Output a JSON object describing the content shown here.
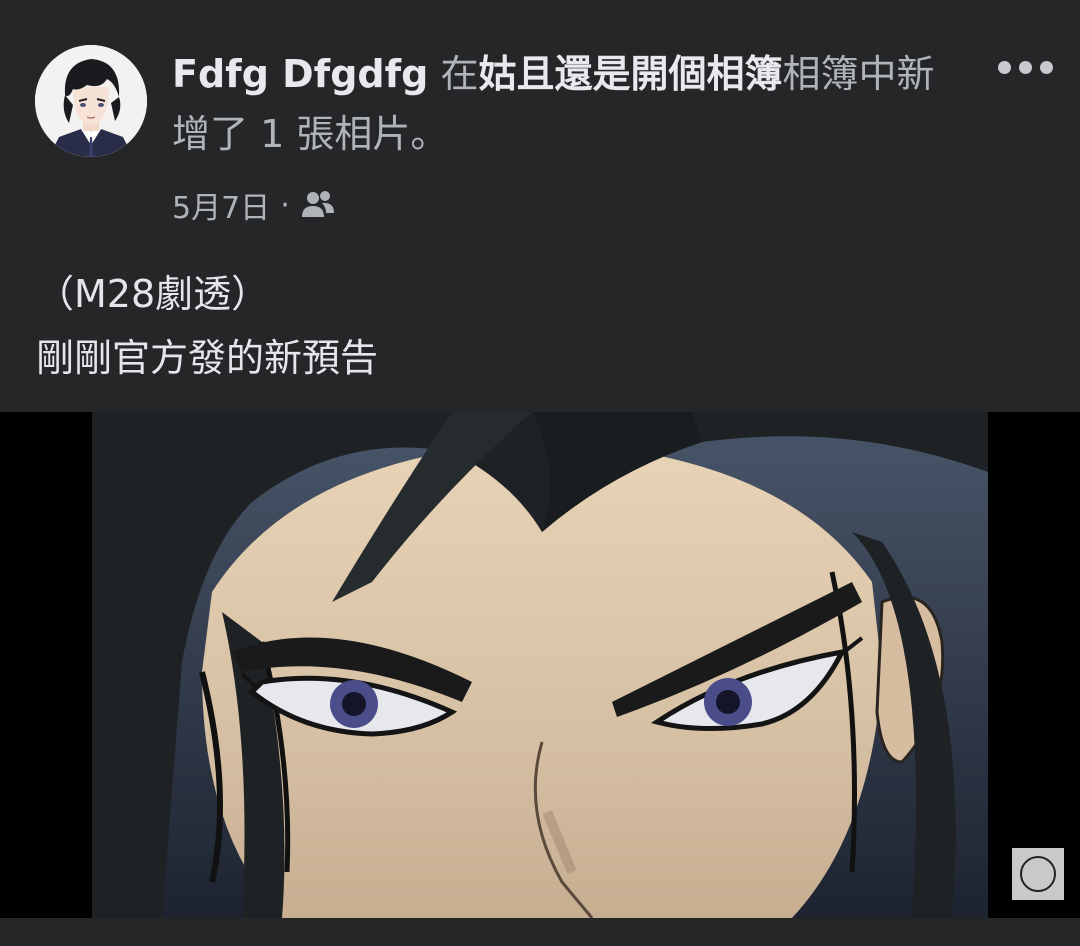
{
  "post": {
    "author": "Fdfg Dfgdfg",
    "action_prefix": "在",
    "album_name": "姑且還是開個相簿",
    "action_suffix": "相簿中新增了 1 張相片。",
    "date": "5月7日",
    "separator": "·",
    "audience_icon": "friends-icon",
    "caption_lines": [
      "（M28劇透）",
      "剛剛官方發的新預告"
    ],
    "more_icon": "more-dots-icon",
    "media": {
      "type": "anime-screenshot",
      "watermark_logo": "toho-logo"
    }
  },
  "colors": {
    "background": "#252628",
    "primary_text": "#e4e6eb",
    "secondary_text": "#b0b3b8"
  }
}
